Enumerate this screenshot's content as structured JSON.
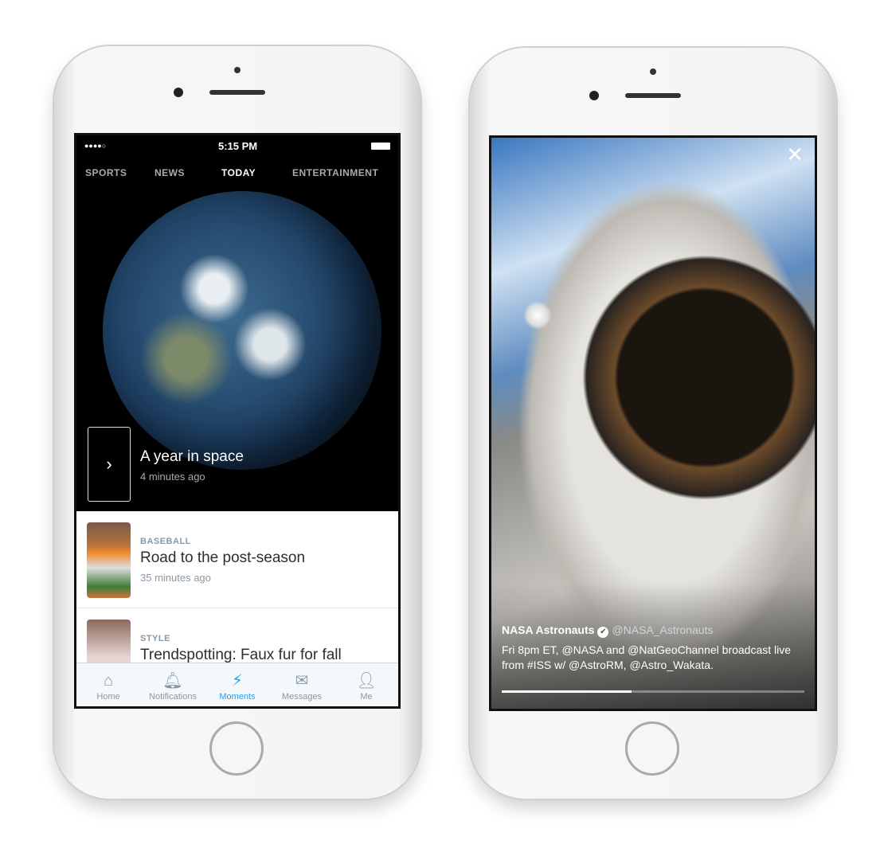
{
  "left_phone": {
    "status": {
      "signal": "●●●●○",
      "time": "5:15 PM",
      "battery": "battery-icon"
    },
    "tabs": [
      "SPORTS",
      "NEWS",
      "TODAY",
      "ENTERTAINMENT"
    ],
    "active_tab": "TODAY",
    "hero": {
      "title": "A year in space",
      "time": "4 minutes ago",
      "arrow": "›"
    },
    "items": [
      {
        "category": "BASEBALL",
        "title": "Road to the post-season",
        "time": "35 minutes ago"
      },
      {
        "category": "STYLE",
        "title": "Trendspotting: Faux fur for fall"
      }
    ],
    "tabbar": [
      {
        "label": "Home",
        "icon": "⌂"
      },
      {
        "label": "Notifications",
        "icon": "🔔︎"
      },
      {
        "label": "Moments",
        "icon": "⚡︎"
      },
      {
        "label": "Messages",
        "icon": "✉"
      },
      {
        "label": "Me",
        "icon": "👤︎"
      }
    ],
    "accent": "#1da1f2"
  },
  "right_phone": {
    "close": "✕",
    "tweet": {
      "name": "NASA Astronauts",
      "verified": "✔",
      "handle": "@NASA_Astronauts",
      "text": "Fri 8pm ET, @NASA and @NatGeoChannel broadcast live from #ISS w/ @AstroRM, @Astro_Wakata."
    },
    "progress": 0.43
  }
}
